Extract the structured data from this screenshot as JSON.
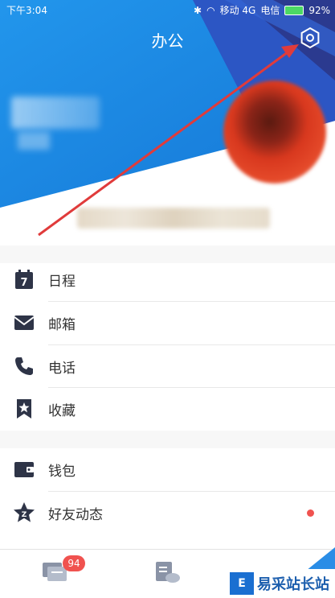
{
  "status_bar": {
    "time": "下午3:04",
    "carrier1": "移动 4G",
    "carrier2": "电信",
    "battery": "92%"
  },
  "header": {
    "title": "办公",
    "settings_icon": "settings-hexagon-icon"
  },
  "menu": {
    "items": [
      {
        "label": "日程",
        "icon": "calendar-icon"
      },
      {
        "label": "邮箱",
        "icon": "mail-icon"
      },
      {
        "label": "电话",
        "icon": "phone-icon"
      },
      {
        "label": "收藏",
        "icon": "bookmark-star-icon"
      },
      {
        "label": "钱包",
        "icon": "wallet-icon"
      },
      {
        "label": "好友动态",
        "icon": "friends-feed-icon"
      }
    ]
  },
  "bottom_tabs": {
    "messages_badge": "94",
    "icons": [
      "messages-icon",
      "cloud-file-icon",
      "shape-icon"
    ]
  },
  "watermark": {
    "text": "易采站长站",
    "logo": "E"
  },
  "colors": {
    "primary_blue": "#1e88e5",
    "dark_blue": "#2b3a8f",
    "accent_red": "#f0524f",
    "annotation_arrow": "#e03b3b"
  }
}
